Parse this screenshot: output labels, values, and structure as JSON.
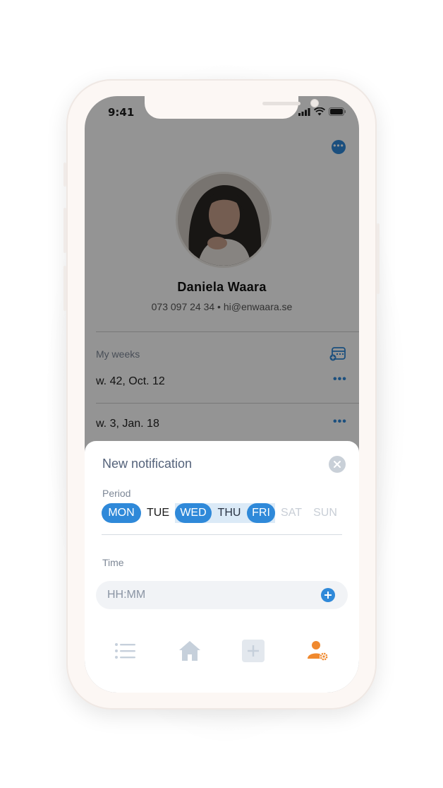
{
  "status_bar": {
    "time": "9:41"
  },
  "profile": {
    "name": "Daniela Waara",
    "contact": "073 097 24 34 • hi@enwaara.se"
  },
  "weeks": {
    "label": "My weeks",
    "items": [
      {
        "label": "w. 42,  Oct. 12"
      },
      {
        "label": "w. 3,  Jan. 18"
      }
    ]
  },
  "notification": {
    "title": "New notification",
    "period_label": "Period",
    "days": [
      {
        "label": "MON",
        "state": "selected"
      },
      {
        "label": "TUE",
        "state": "normal"
      },
      {
        "label": "WED",
        "state": "selected"
      },
      {
        "label": "THU",
        "state": "in-range"
      },
      {
        "label": "FRI",
        "state": "selected"
      },
      {
        "label": "SAT",
        "state": "disabled"
      },
      {
        "label": "SUN",
        "state": "disabled"
      }
    ],
    "time_label": "Time",
    "time_placeholder": "HH:MM"
  },
  "tabbar": {
    "items": [
      {
        "icon": "list-icon",
        "active": false
      },
      {
        "icon": "home-icon",
        "active": false
      },
      {
        "icon": "add-square-icon",
        "active": false
      },
      {
        "icon": "user-settings-icon",
        "active": true
      }
    ]
  },
  "colors": {
    "accent": "#2f89d9",
    "active_tab": "#f0892e",
    "inactive_tab": "#c6d0db",
    "range_band": "#dbeaf7"
  }
}
